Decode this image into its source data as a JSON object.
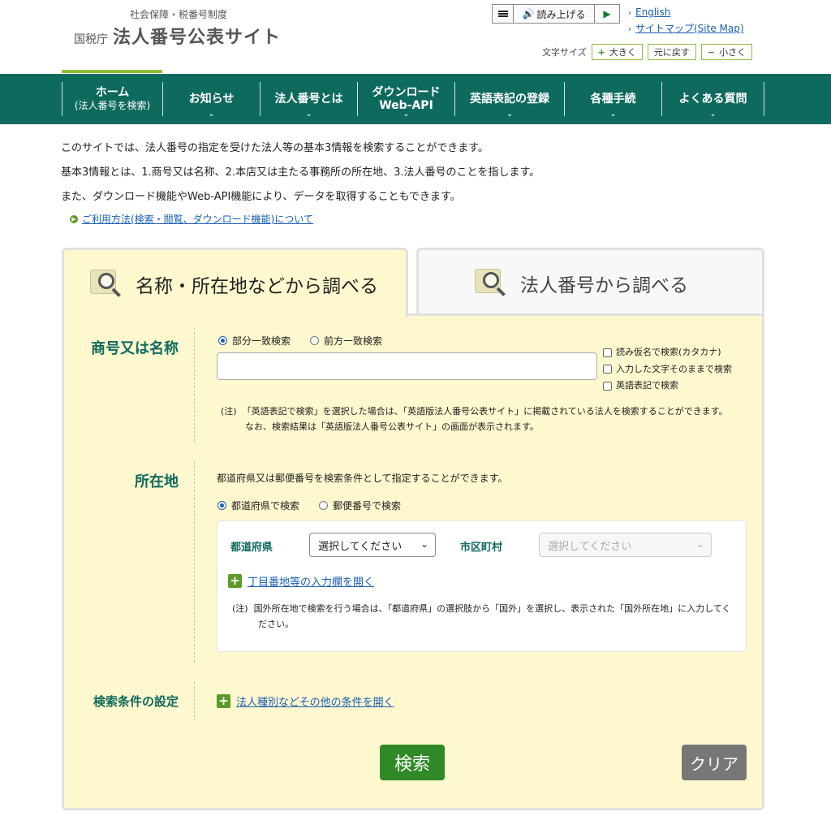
{
  "header": {
    "subtitle": "社会保障・税番号制度",
    "agency": "国税庁",
    "title": "法人番号公表サイト",
    "readbar": {
      "read_label": "読み上げる"
    },
    "links": [
      "English",
      "サイトマップ(Site Map)"
    ],
    "font_size": {
      "label": "文字サイズ",
      "larger": "大きく",
      "reset": "元に戻す",
      "smaller": "小さく"
    }
  },
  "nav": {
    "items": [
      {
        "line1": "ホーム",
        "line2": "(法人番号を検索)"
      },
      {
        "line1": "お知らせ",
        "line2": ""
      },
      {
        "line1": "法人番号とは",
        "line2": ""
      },
      {
        "line1": "ダウンロード",
        "line2": "Web-API"
      },
      {
        "line1": "英語表記の登録",
        "line2": ""
      },
      {
        "line1": "各種手続",
        "line2": ""
      },
      {
        "line1": "よくある質問",
        "line2": ""
      }
    ]
  },
  "intro": {
    "lines": [
      "このサイトでは、法人番号の指定を受けた法人等の基本3情報を検索することができます。",
      "基本3情報とは、1.商号又は名称、2.本店又は主たる事務所の所在地、3.法人番号のことを指します。",
      "また、ダウンロード機能やWeb-API機能により、データを取得することもできます。"
    ],
    "usage_link": "ご利用方法(検索・閲覧、ダウンロード機能)について"
  },
  "tabs": [
    {
      "label": "名称・所在地などから調べる",
      "active": true
    },
    {
      "label": "法人番号から調べる",
      "active": false
    }
  ],
  "name_section": {
    "label": "商号又は名称",
    "match_options": [
      "部分一致検索",
      "前方一致検索"
    ],
    "selected_match": "部分一致検索",
    "input_value": "",
    "checkboxes": [
      "読み仮名で検索(カタカナ)",
      "入力した文字そのままで検索",
      "英語表記で検索"
    ],
    "note_prefix": "(注)",
    "note_line1": "「英語表記で検索」を選択した場合は、「英語版法人番号公表サイト」に掲載されている法人を検索することができます。",
    "note_line2": "なお、検索結果は「英語版法人番号公表サイト」の画面が表示されます。"
  },
  "location_section": {
    "label": "所在地",
    "description": "都道府県又は郵便番号を検索条件として指定することができます。",
    "options": [
      "都道府県で検索",
      "郵便番号で検索"
    ],
    "selected": "都道府県で検索",
    "prefecture_label": "都道府県",
    "prefecture_value": "選択してください",
    "city_label": "市区町村",
    "city_value": "選択してください",
    "expand_link": "丁目番地等の入力欄を開く",
    "note_prefix": "(注)",
    "note_line1": "国外所在地で検索を行う場合は、「都道府県」の選択肢から「国外」を選択し、表示された「国外所在地」に入力してく",
    "note_line2": "ださい。"
  },
  "conditions_section": {
    "label": "検索条件の設定",
    "expand_link": "法人種別などその他の条件を開く"
  },
  "buttons": {
    "search": "検索",
    "clear": "クリア"
  }
}
